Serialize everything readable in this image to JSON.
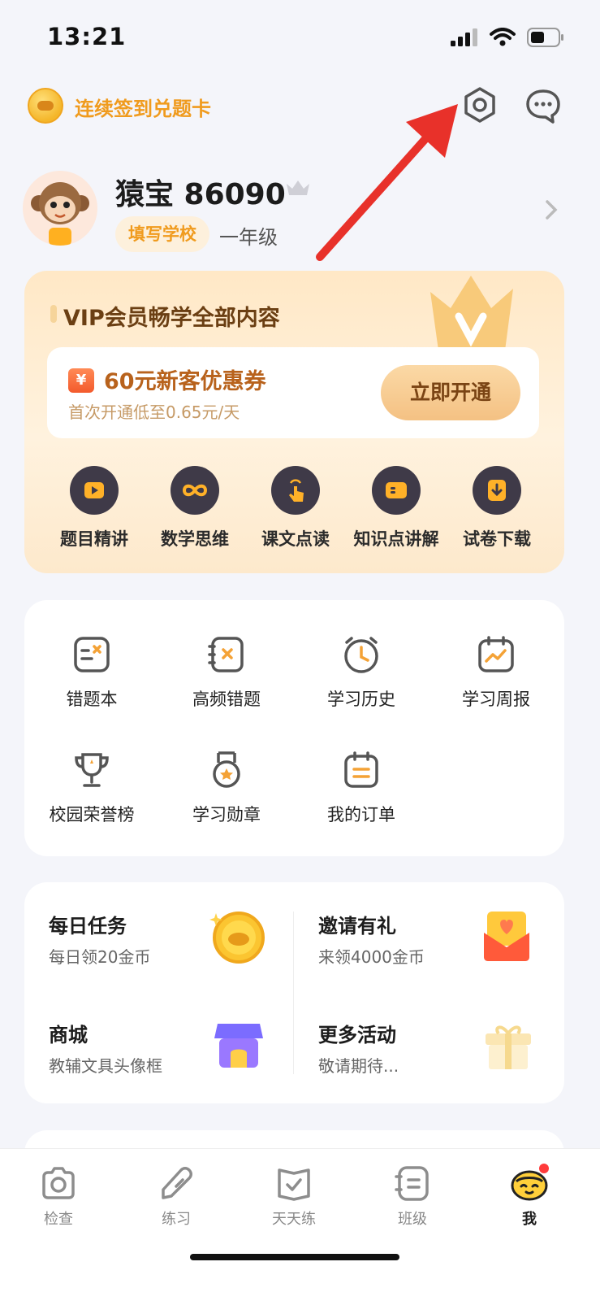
{
  "status": {
    "time": "13:21"
  },
  "topbar": {
    "checkin_text": "连续签到兑题卡"
  },
  "profile": {
    "username": "猿宝 86090",
    "school_tag": "填写学校",
    "grade": "一年级"
  },
  "vip": {
    "title": "VIP会员畅学全部内容",
    "coupon_icon": "¥",
    "coupon_title": "60元新客优惠券",
    "coupon_sub": "首次开通低至0.65元/天",
    "open_button": "立即开通",
    "features": [
      {
        "label": "题目精讲",
        "icon": "play-icon"
      },
      {
        "label": "数学思维",
        "icon": "infinity-icon"
      },
      {
        "label": "课文点读",
        "icon": "tap-hand-icon"
      },
      {
        "label": "知识点讲解",
        "icon": "card-icon"
      },
      {
        "label": "试卷下载",
        "icon": "download-icon"
      }
    ]
  },
  "tools": [
    {
      "label": "错题本",
      "icon": "wrong-notebook-icon"
    },
    {
      "label": "高频错题",
      "icon": "frequent-mistakes-icon"
    },
    {
      "label": "学习历史",
      "icon": "clock-icon"
    },
    {
      "label": "学习周报",
      "icon": "weekly-report-icon"
    },
    {
      "label": "校园荣誉榜",
      "icon": "trophy-icon"
    },
    {
      "label": "学习勋章",
      "icon": "medal-icon"
    },
    {
      "label": "我的订单",
      "icon": "order-icon"
    }
  ],
  "activities": [
    {
      "title": "每日任务",
      "subtitle": "每日领20金币",
      "icon": "gold-coin-icon"
    },
    {
      "title": "邀请有礼",
      "subtitle": "来领4000金币",
      "icon": "invite-envelope-icon"
    },
    {
      "title": "商城",
      "subtitle": "教辅文具头像框",
      "icon": "shop-icon"
    },
    {
      "title": "更多活动",
      "subtitle": "敬请期待...",
      "icon": "gift-icon"
    }
  ],
  "tabbar": [
    {
      "label": "检查",
      "icon": "camera-icon"
    },
    {
      "label": "练习",
      "icon": "pencil-icon"
    },
    {
      "label": "天天练",
      "icon": "daily-practice-icon"
    },
    {
      "label": "班级",
      "icon": "class-icon"
    },
    {
      "label": "我",
      "icon": "me-mascot-icon",
      "active": true
    }
  ],
  "colors": {
    "accent": "#f09b1e",
    "vip_text": "#6b3f13",
    "annotation_arrow": "#e8312a"
  }
}
